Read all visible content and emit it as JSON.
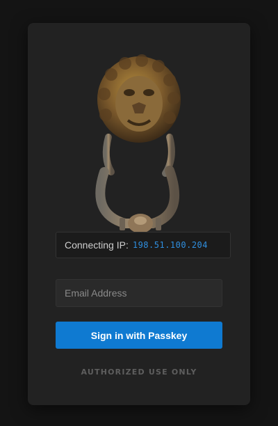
{
  "login": {
    "ip_label": "Connecting IP:",
    "ip_value": "198.51.100.204",
    "email_placeholder": "Email Address",
    "email_value": "",
    "signin_label": "Sign in with Passkey",
    "footer_text": "AUTHORIZED USE ONLY"
  },
  "colors": {
    "background": "#141414",
    "card": "#222222",
    "accent": "#0f7ad1",
    "ip_text": "#2f8fe0"
  },
  "icons": {
    "emblem": "lion-door-knocker-image"
  }
}
